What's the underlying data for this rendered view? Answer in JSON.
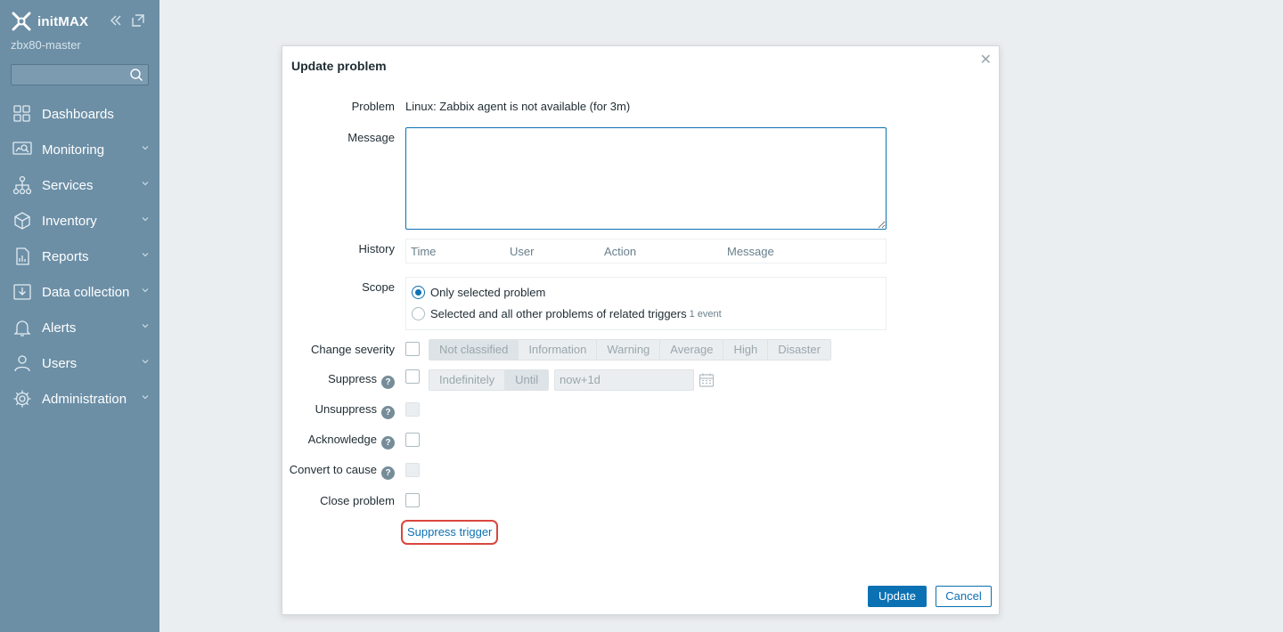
{
  "sidebar": {
    "brand": "initMAX",
    "server_name": "zbx80-master",
    "search_placeholder": "",
    "items": [
      {
        "label": "Dashboards",
        "icon": "dashboards-icon",
        "has_submenu": false
      },
      {
        "label": "Monitoring",
        "icon": "monitoring-icon",
        "has_submenu": true
      },
      {
        "label": "Services",
        "icon": "services-icon",
        "has_submenu": true
      },
      {
        "label": "Inventory",
        "icon": "inventory-icon",
        "has_submenu": true
      },
      {
        "label": "Reports",
        "icon": "reports-icon",
        "has_submenu": true
      },
      {
        "label": "Data collection",
        "icon": "data-collection-icon",
        "has_submenu": true
      },
      {
        "label": "Alerts",
        "icon": "alerts-icon",
        "has_submenu": true
      },
      {
        "label": "Users",
        "icon": "users-icon",
        "has_submenu": true
      },
      {
        "label": "Administration",
        "icon": "administration-icon",
        "has_submenu": true
      }
    ]
  },
  "dialog": {
    "title": "Update problem",
    "close_glyph": "✕",
    "problem_label": "Problem",
    "problem_value": "Linux: Zabbix agent is not available (for 3m)",
    "message_label": "Message",
    "message_value": "",
    "history_label": "History",
    "history_columns": [
      "Time",
      "User",
      "Action",
      "Message"
    ],
    "scope_label": "Scope",
    "scope_options": [
      {
        "label": "Only selected problem",
        "note": "",
        "selected": true
      },
      {
        "label": "Selected and all other problems of related triggers",
        "note": "1 event",
        "selected": false
      }
    ],
    "change_severity_label": "Change severity",
    "severities": [
      "Not classified",
      "Information",
      "Warning",
      "Average",
      "High",
      "Disaster"
    ],
    "selected_severity": "Not classified",
    "suppress_label": "Suppress",
    "suppress_modes": [
      "Indefinitely",
      "Until"
    ],
    "selected_suppress_mode": "Until",
    "suppress_until_value": "now+1d",
    "unsuppress_label": "Unsuppress",
    "acknowledge_label": "Acknowledge",
    "convert_label": "Convert to cause",
    "close_problem_label": "Close problem",
    "suppress_trigger_link": "Suppress trigger",
    "help_glyph": "?",
    "update_button": "Update",
    "cancel_button": "Cancel"
  },
  "colors": {
    "sidebar_bg": "#6c8fa6",
    "primary": "#0b71b3",
    "highlight_ring": "#d9463e",
    "page_bg": "#ebeef0"
  }
}
